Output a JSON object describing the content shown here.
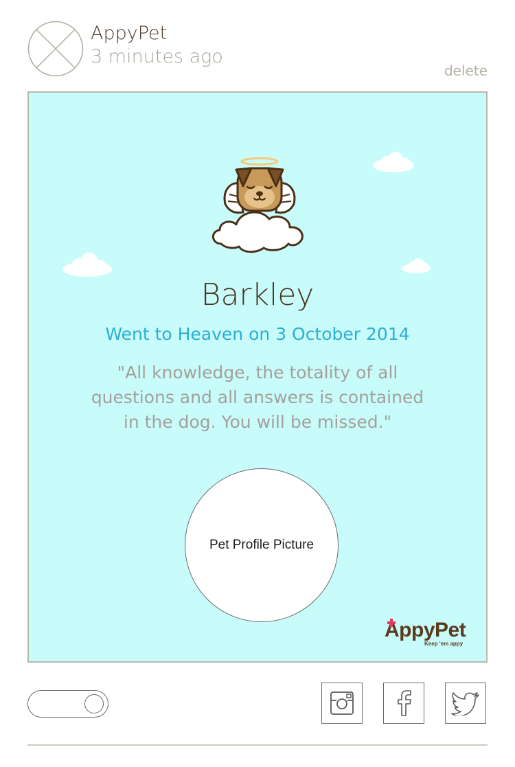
{
  "header": {
    "app_name": "AppyPet",
    "timestamp": "3 minutes ago",
    "delete_label": "delete",
    "avatar_icon": "placeholder-image-icon"
  },
  "card": {
    "background_color": "#c8fcfb",
    "illustration_icon": "angel-dog-on-cloud-icon",
    "pet_name": "Barkley",
    "passing_text": "Went to Heaven on 3 October 2014",
    "quote": "\"All knowledge, the totality of all questions and all answers is contained in the dog. You will be missed.\"",
    "profile_picture_label": "Pet Profile Picture",
    "brand": {
      "name": "AppyPet",
      "tagline": "Keep 'em appy",
      "color": "#5a3a1c"
    }
  },
  "footer": {
    "toggle": {
      "state": "on"
    },
    "share_buttons": [
      {
        "icon": "instagram-icon"
      },
      {
        "icon": "facebook-icon"
      },
      {
        "icon": "twitter-icon"
      }
    ]
  },
  "colors": {
    "title": "#4a3320",
    "accent_blue": "#2aaed1",
    "muted_text": "#a3a09a"
  }
}
